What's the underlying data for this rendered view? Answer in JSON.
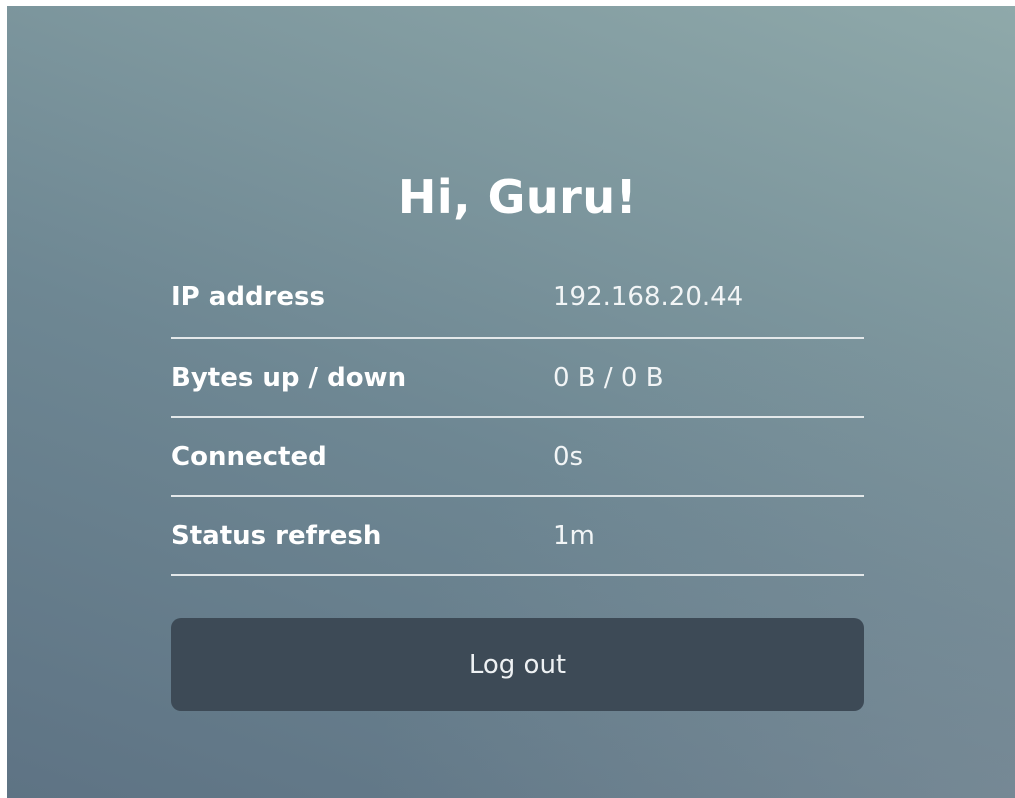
{
  "greeting": "Hi, Guru!",
  "info": [
    {
      "label": "IP address",
      "value": "192.168.20.44"
    },
    {
      "label": "Bytes up / down",
      "value": "0 B / 0 B"
    },
    {
      "label": "Connected",
      "value": "0s"
    },
    {
      "label": "Status refresh",
      "value": "1m"
    }
  ],
  "logout_label": "Log out",
  "colors": {
    "background_start": "#5e7384",
    "background_end": "#8fa9aa",
    "button": "#3d4a56",
    "text": "#ffffff"
  }
}
